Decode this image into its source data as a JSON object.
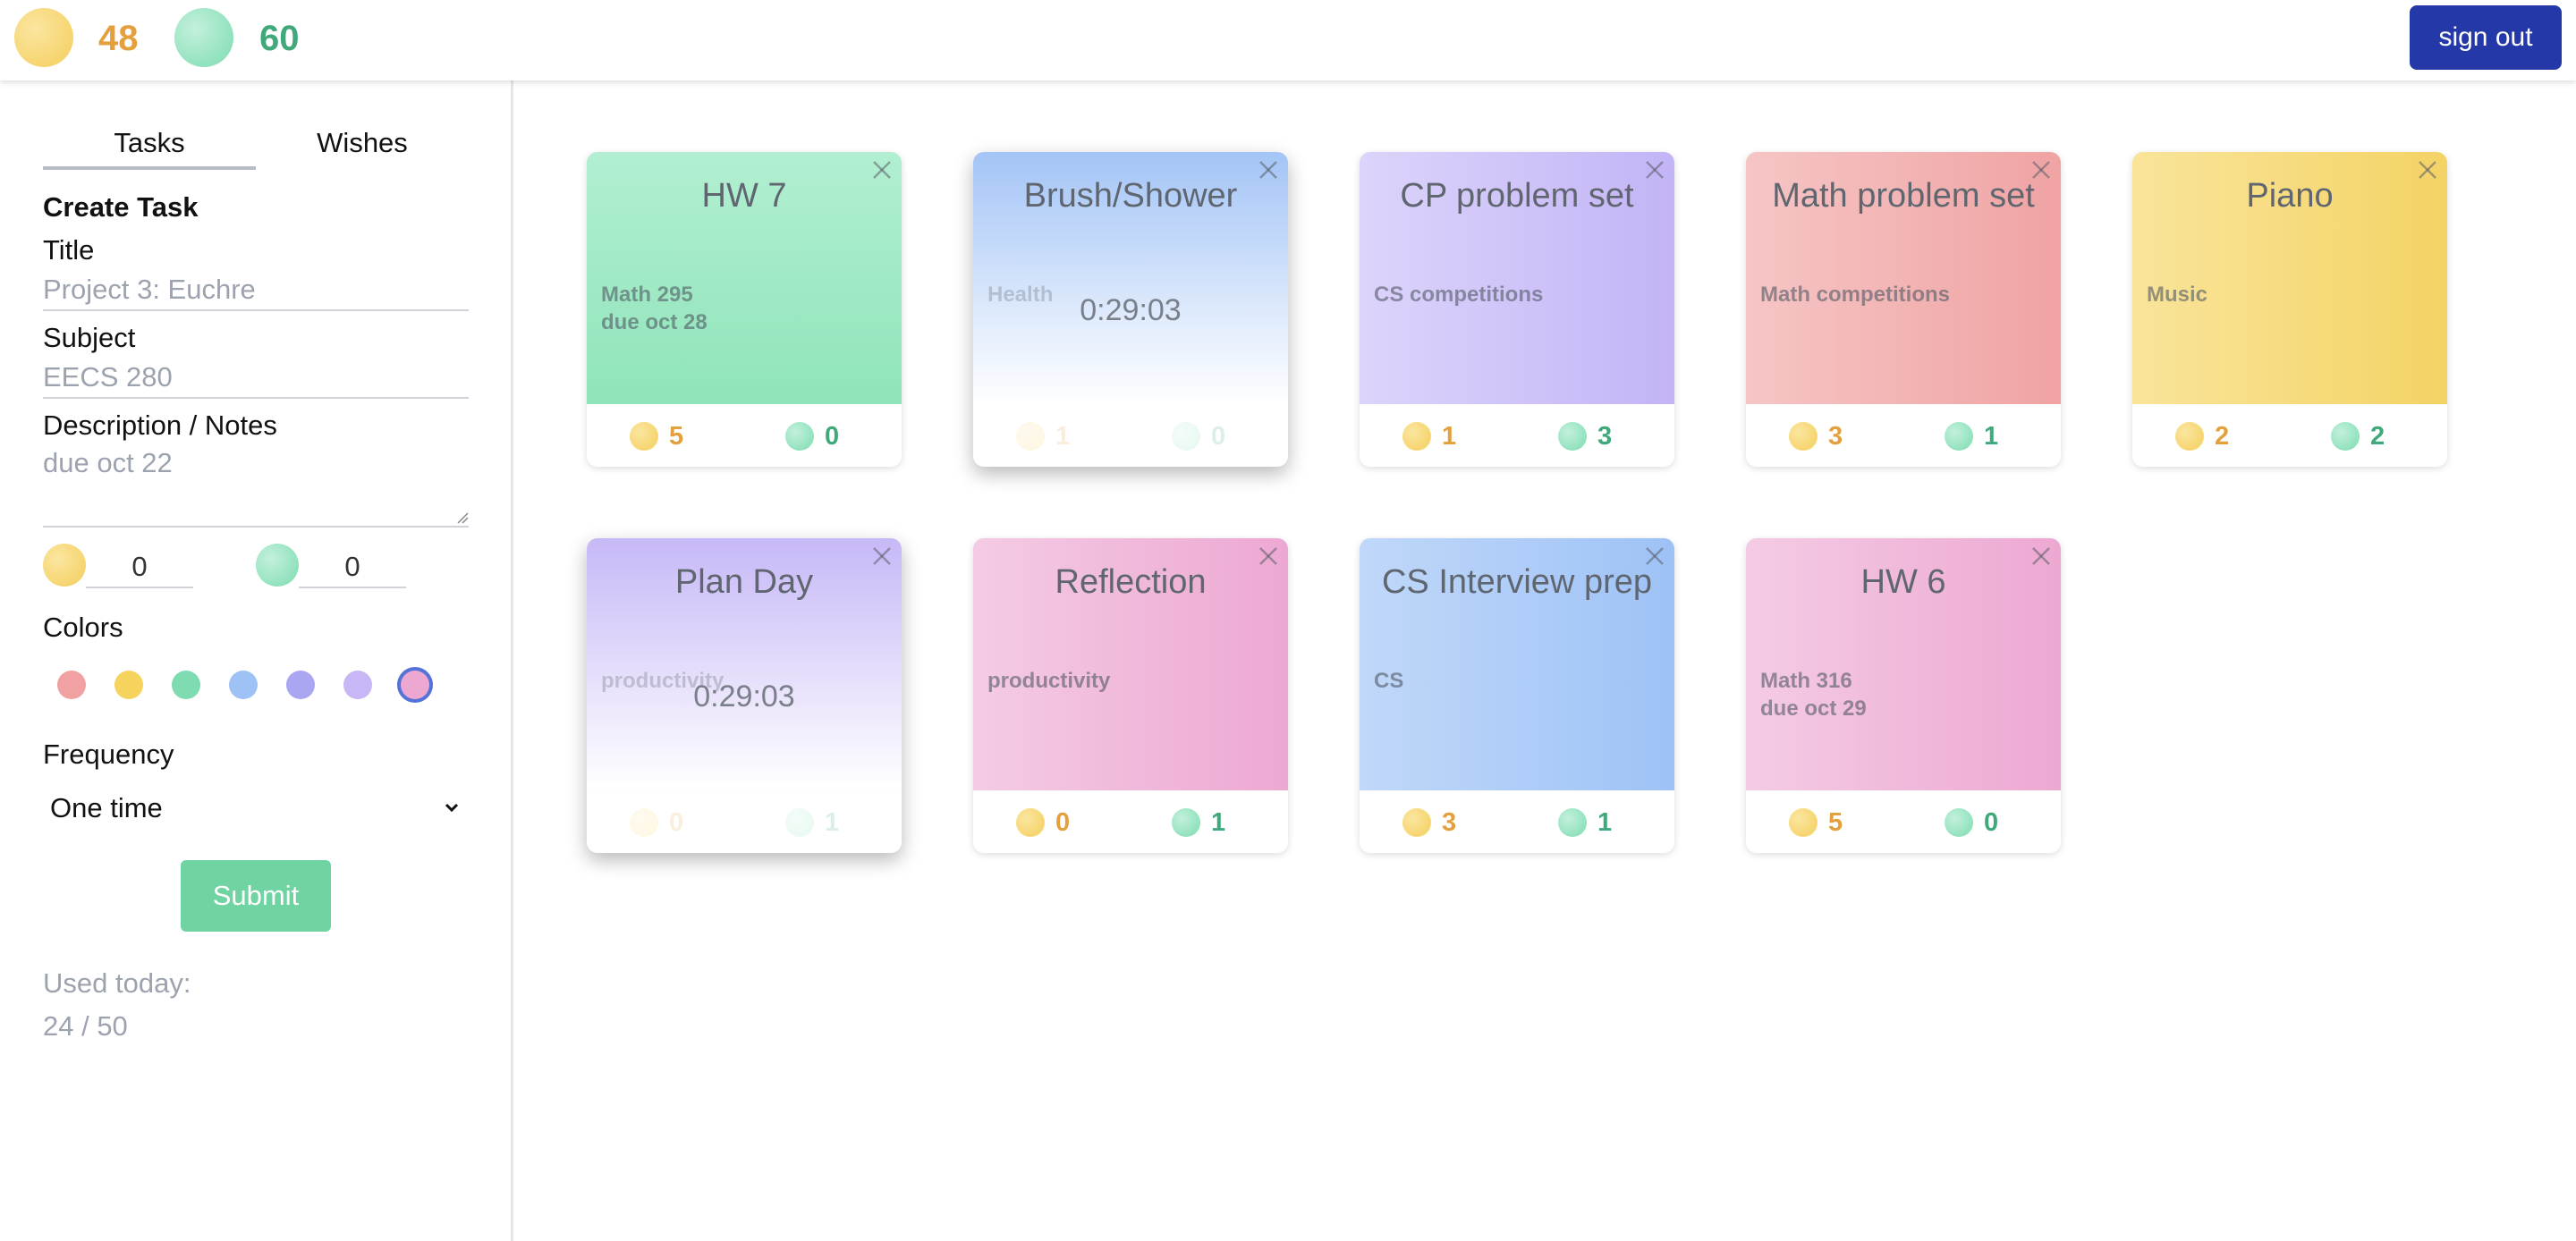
{
  "header": {
    "gold_count": "48",
    "green_count": "60",
    "sign_out_label": "sign out"
  },
  "sidebar": {
    "tabs": [
      {
        "label": "Tasks",
        "active": true
      },
      {
        "label": "Wishes",
        "active": false
      }
    ],
    "form": {
      "heading": "Create Task",
      "title_label": "Title",
      "title_placeholder": "Project 3: Euchre",
      "subject_label": "Subject",
      "subject_placeholder": "EECS 280",
      "notes_label": "Description / Notes",
      "notes_placeholder": "due oct 22",
      "gold_value": "0",
      "green_value": "0",
      "colors_label": "Colors",
      "colors": [
        "#f1a1a1",
        "#f5d35c",
        "#7fdcb0",
        "#9ec2f6",
        "#aaa6f2",
        "#c8b7f6",
        "#eda8d2"
      ],
      "selected_color": "#eda8d2",
      "frequency_label": "Frequency",
      "frequency_value": "One time",
      "submit_label": "Submit"
    },
    "usage": {
      "label": "Used today:",
      "value": "24 / 50"
    }
  },
  "cards": [
    {
      "title": "HW 7",
      "subtitle": "Math 295\ndue oct 28",
      "timer": "",
      "gold": "5",
      "green": "0",
      "theme": "green"
    },
    {
      "title": "Brush/Shower",
      "subtitle": "Health",
      "timer": "0:29:03",
      "gold": "1",
      "green": "0",
      "theme": "blue-fade"
    },
    {
      "title": "CP problem set",
      "subtitle": "CS competitions",
      "timer": "",
      "gold": "1",
      "green": "3",
      "theme": "purple"
    },
    {
      "title": "Math problem set",
      "subtitle": "Math competitions",
      "timer": "",
      "gold": "3",
      "green": "1",
      "theme": "red"
    },
    {
      "title": "Piano",
      "subtitle": "Music",
      "timer": "",
      "gold": "2",
      "green": "2",
      "theme": "yellow"
    },
    {
      "title": "Plan Day",
      "subtitle": "productivity",
      "timer": "0:29:03",
      "gold": "0",
      "green": "1",
      "theme": "purple-fade"
    },
    {
      "title": "Reflection",
      "subtitle": "productivity",
      "timer": "",
      "gold": "0",
      "green": "1",
      "theme": "pink"
    },
    {
      "title": "CS Interview prep",
      "subtitle": "CS",
      "timer": "",
      "gold": "3",
      "green": "1",
      "theme": "blue"
    },
    {
      "title": "HW 6",
      "subtitle": "Math 316\ndue oct 29",
      "timer": "",
      "gold": "5",
      "green": "0",
      "theme": "pink"
    }
  ],
  "icons": {
    "gold": "gold-coin-icon",
    "green": "green-coin-icon",
    "close": "close-icon",
    "chevron": "chevron-down-icon"
  }
}
